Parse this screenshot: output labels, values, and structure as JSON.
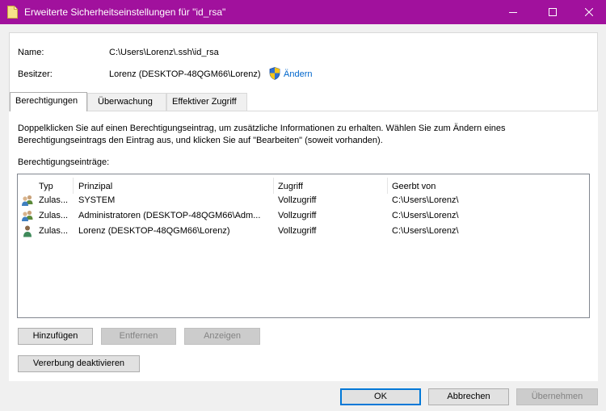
{
  "window": {
    "title": "Erweiterte Sicherheitseinstellungen für \"id_rsa\""
  },
  "info": {
    "name_label": "Name:",
    "name_value": "C:\\Users\\Lorenz\\.ssh\\id_rsa",
    "owner_label": "Besitzer:",
    "owner_value": "Lorenz (DESKTOP-48QGM66\\Lorenz)",
    "change_link": "Ändern"
  },
  "tabs": [
    {
      "label": "Berechtigungen",
      "active": true
    },
    {
      "label": "Überwachung",
      "active": false
    },
    {
      "label": "Effektiver Zugriff",
      "active": false
    }
  ],
  "permissions": {
    "description": "Doppelklicken Sie auf einen Berechtigungseintrag, um zusätzliche Informationen zu erhalten. Wählen Sie zum Ändern eines Berechtigungseintrags den Eintrag aus, und klicken Sie auf \"Bearbeiten\" (soweit vorhanden).",
    "description_line1": "Doppelklicken Sie auf einen Berechtigungseintrag, um zusätzliche Informationen zu erhalten. Wählen Sie zum Ändern eines",
    "description_line2": "Berechtigungseintrags den Eintrag aus, und klicken Sie auf \"Bearbeiten\" (soweit vorhanden).",
    "entries_label": "Berechtigungseinträge:",
    "columns": [
      "Typ",
      "Prinzipal",
      "Zugriff",
      "Geerbt von"
    ],
    "rows": [
      {
        "icon": "group-users-icon",
        "type": "Zulas...",
        "principal": "SYSTEM",
        "access": "Vollzugriff",
        "inherited": "C:\\Users\\Lorenz\\"
      },
      {
        "icon": "group-users-icon",
        "type": "Zulas...",
        "principal": "Administratoren (DESKTOP-48QGM66\\Adm...",
        "access": "Vollzugriff",
        "inherited": "C:\\Users\\Lorenz\\"
      },
      {
        "icon": "single-user-icon",
        "type": "Zulas...",
        "principal": "Lorenz (DESKTOP-48QGM66\\Lorenz)",
        "access": "Vollzugriff",
        "inherited": "C:\\Users\\Lorenz\\"
      }
    ]
  },
  "buttons": {
    "add": "Hinzufügen",
    "remove": "Entfernen",
    "view": "Anzeigen",
    "disable_inheritance": "Vererbung deaktivieren",
    "ok": "OK",
    "cancel": "Abbrechen",
    "apply": "Übernehmen"
  },
  "colors": {
    "titlebar": "#a1119d",
    "link": "#0066cc",
    "default_button_border": "#0078d7"
  }
}
